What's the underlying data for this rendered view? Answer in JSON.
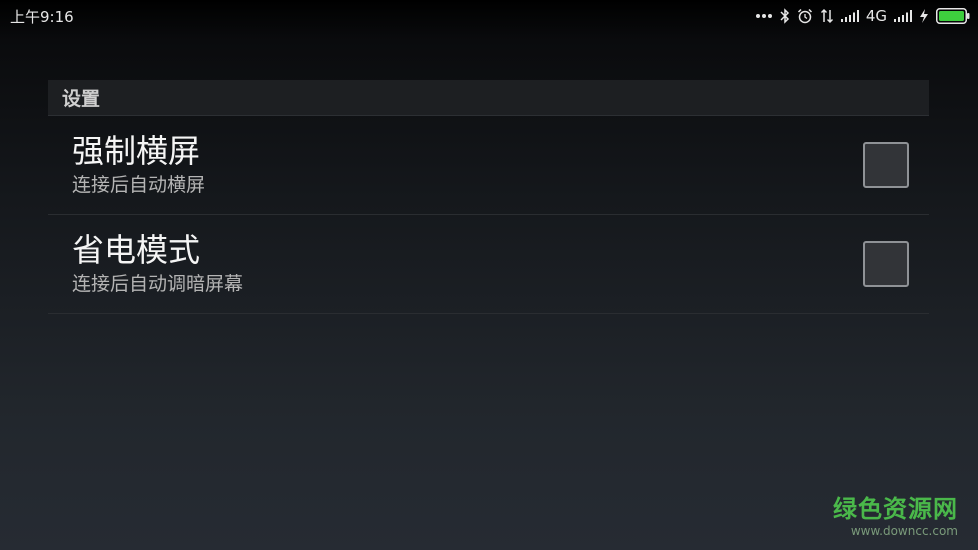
{
  "status_bar": {
    "time": "上午9:16",
    "network_label": "4G",
    "battery_color": "#3ecf3e"
  },
  "settings": {
    "section_title": "设置",
    "items": [
      {
        "title": "强制横屏",
        "summary": "连接后自动横屏",
        "checked": false
      },
      {
        "title": "省电模式",
        "summary": "连接后自动调暗屏幕",
        "checked": false
      }
    ]
  },
  "watermark": {
    "title": "绿色资源网",
    "url": "www.downcc.com"
  }
}
